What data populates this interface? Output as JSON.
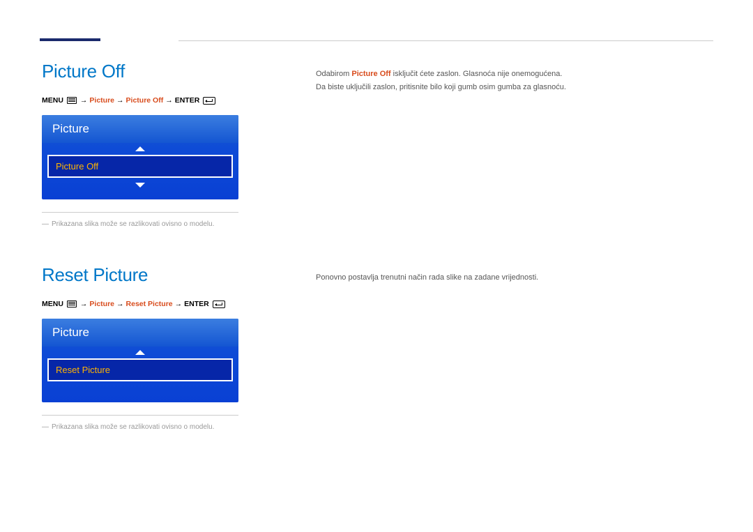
{
  "section1": {
    "heading": "Picture Off",
    "breadcrumb": {
      "menu": "MENU",
      "step1": "Picture",
      "step2": "Picture Off",
      "enter": "ENTER"
    },
    "panel": {
      "title": "Picture",
      "selected": "Picture Off"
    },
    "footnote": "Prikazana slika može se razlikovati ovisno o modelu.",
    "body_pre": "Odabirom ",
    "body_bold": "Picture Off",
    "body_post": " isključit ćete zaslon. Glasnoća nije onemogućena.",
    "body_line2": "Da biste uključili zaslon, pritisnite bilo koji gumb osim gumba za glasnoću."
  },
  "section2": {
    "heading": "Reset Picture",
    "breadcrumb": {
      "menu": "MENU",
      "step1": "Picture",
      "step2": "Reset Picture",
      "enter": "ENTER"
    },
    "panel": {
      "title": "Picture",
      "selected": "Reset Picture"
    },
    "footnote": "Prikazana slika može se razlikovati ovisno o modelu.",
    "body": "Ponovno postavlja trenutni način rada slike na zadane vrijednosti."
  },
  "arrow": "→"
}
